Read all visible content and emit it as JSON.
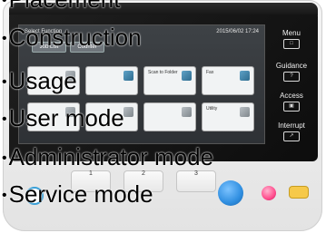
{
  "screen": {
    "title": "Select Function",
    "datetime": "2015/06/02 17:24",
    "tabs": [
      "Job List",
      "Counter"
    ],
    "tiles": [
      "",
      "",
      "Scan to Folder",
      "Fax",
      "",
      "",
      "",
      "Utility"
    ]
  },
  "hard_keys": [
    {
      "label": "Menu",
      "glyph": "□"
    },
    {
      "label": "Guidance",
      "glyph": "?"
    },
    {
      "label": "Access",
      "glyph": "▣"
    },
    {
      "label": "Interrupt",
      "glyph": "↗"
    }
  ],
  "register_keys": [
    "1",
    "2",
    "3"
  ],
  "overlay": {
    "items": [
      "Placement",
      "Construction",
      "Usage",
      "User mode",
      "Administrator mode",
      "Service mode"
    ]
  },
  "colors": {
    "start_button": "#2f8ee0",
    "stop_button": "#ff4d8d",
    "id_button": "#f6c94a"
  }
}
